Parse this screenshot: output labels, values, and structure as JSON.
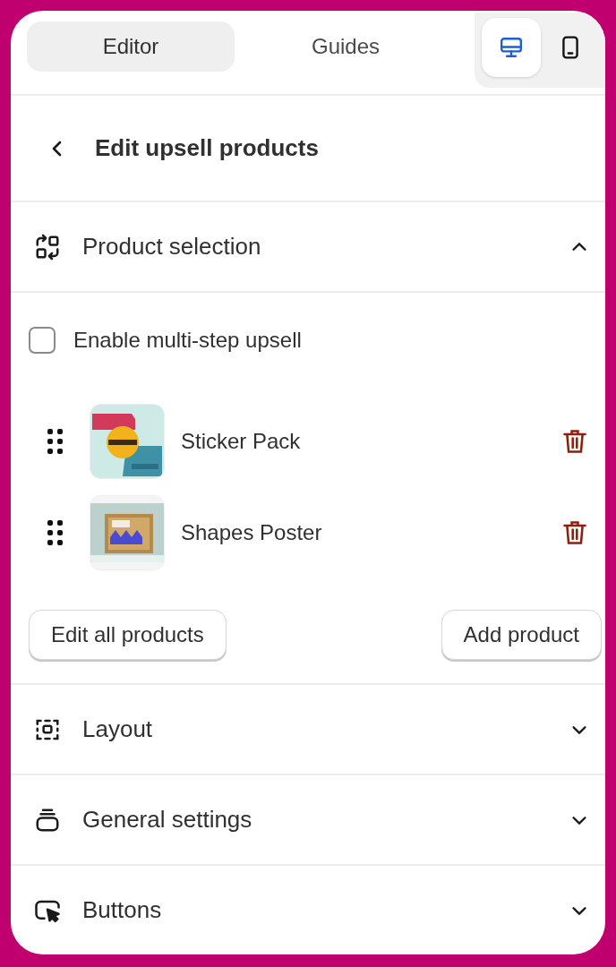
{
  "top_tabs": [
    {
      "label": "Editor",
      "selected": true
    },
    {
      "label": "Guides",
      "selected": false
    }
  ],
  "device_toggle": [
    {
      "kind": "desktop",
      "selected": true
    },
    {
      "kind": "mobile",
      "selected": false
    }
  ],
  "header": {
    "title": "Edit upsell products"
  },
  "sections": [
    {
      "kind": "swap",
      "title": "Product selection",
      "expanded": true,
      "content": {
        "multi_step": {
          "label": "Enable multi-step upsell",
          "checked": false
        },
        "products": [
          {
            "name": "Sticker Pack"
          },
          {
            "name": "Shapes Poster"
          }
        ],
        "buttons": [
          "Edit all products",
          "Add product"
        ]
      }
    },
    {
      "kind": "layout",
      "title": "Layout",
      "expanded": false
    },
    {
      "kind": "stack",
      "title": "General settings",
      "expanded": false
    },
    {
      "kind": "cursor",
      "title": "Buttons",
      "expanded": false
    }
  ]
}
